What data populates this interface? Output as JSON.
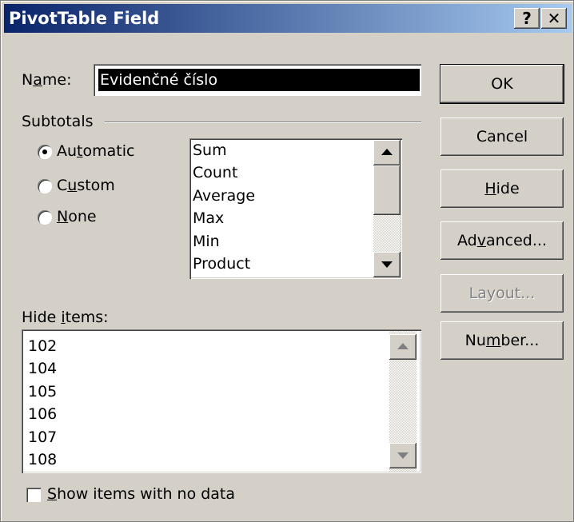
{
  "window": {
    "title": "PivotTable Field",
    "help_glyph": "?",
    "close_glyph": "✕"
  },
  "name": {
    "label_pre": "N",
    "label_u": "a",
    "label_post": "me:",
    "value": "Evidenčné číslo"
  },
  "subtotals": {
    "label": "Subtotals",
    "options": [
      {
        "pre": "Au",
        "u": "t",
        "post": "omatic",
        "selected": true
      },
      {
        "pre": "C",
        "u": "u",
        "post": "stom",
        "selected": false
      },
      {
        "pre": "",
        "u": "N",
        "post": "one",
        "selected": false
      }
    ],
    "functions": [
      "Sum",
      "Count",
      "Average",
      "Max",
      "Min",
      "Product"
    ]
  },
  "hide_items": {
    "label_pre": "Hide ",
    "label_u": "i",
    "label_post": "tems:",
    "items": [
      "102",
      "104",
      "105",
      "106",
      "107",
      "108"
    ]
  },
  "show_no_data": {
    "pre": "",
    "u": "S",
    "post": "how items with no data",
    "checked": false
  },
  "buttons": {
    "ok": "OK",
    "cancel": "Cancel",
    "hide": {
      "pre": "",
      "u": "H",
      "post": "ide"
    },
    "advanced": {
      "pre": "Ad",
      "u": "v",
      "post": "anced..."
    },
    "layout": "Layout...",
    "number": {
      "pre": "Nu",
      "u": "m",
      "post": "ber..."
    }
  }
}
